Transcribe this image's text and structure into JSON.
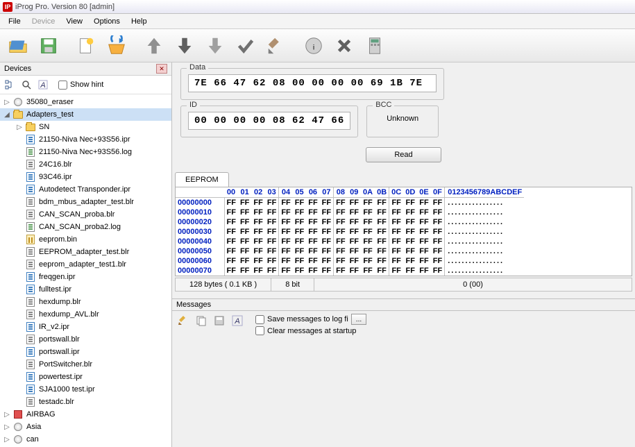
{
  "window": {
    "title": "iProg Pro. Version 80 [admin]"
  },
  "menu": {
    "file": "File",
    "device": "Device",
    "view": "View",
    "options": "Options",
    "help": "Help"
  },
  "devices": {
    "title": "Devices",
    "showhint": "Show hint",
    "tree": [
      {
        "depth": 0,
        "exp": "▷",
        "icon": "light",
        "label": "35080_eraser"
      },
      {
        "depth": 0,
        "exp": "◢",
        "icon": "folder",
        "label": "Adapters_test",
        "selected": true
      },
      {
        "depth": 1,
        "exp": "▷",
        "icon": "folder",
        "label": "SN"
      },
      {
        "depth": 1,
        "exp": "",
        "icon": "ipr",
        "label": "21150-Niva Nec+93S56.ipr"
      },
      {
        "depth": 1,
        "exp": "",
        "icon": "log",
        "label": "21150-Niva Nec+93S56.log"
      },
      {
        "depth": 1,
        "exp": "",
        "icon": "blr",
        "label": "24C16.blr"
      },
      {
        "depth": 1,
        "exp": "",
        "icon": "ipr",
        "label": "93C46.ipr"
      },
      {
        "depth": 1,
        "exp": "",
        "icon": "ipr",
        "label": "Autodetect Transponder.ipr"
      },
      {
        "depth": 1,
        "exp": "",
        "icon": "blr",
        "label": "bdm_mbus_adapter_test.blr"
      },
      {
        "depth": 1,
        "exp": "",
        "icon": "blr",
        "label": "CAN_SCAN_proba.blr"
      },
      {
        "depth": 1,
        "exp": "",
        "icon": "log",
        "label": "CAN_SCAN_proba2.log"
      },
      {
        "depth": 1,
        "exp": "",
        "icon": "bin",
        "label": "eeprom.bin"
      },
      {
        "depth": 1,
        "exp": "",
        "icon": "blr",
        "label": "EEPROM_adapter_test.blr"
      },
      {
        "depth": 1,
        "exp": "",
        "icon": "blr",
        "label": "eeprom_adapter_test1.blr"
      },
      {
        "depth": 1,
        "exp": "",
        "icon": "ipr",
        "label": "freqgen.ipr"
      },
      {
        "depth": 1,
        "exp": "",
        "icon": "ipr",
        "label": "fulltest.ipr"
      },
      {
        "depth": 1,
        "exp": "",
        "icon": "blr",
        "label": "hexdump.blr"
      },
      {
        "depth": 1,
        "exp": "",
        "icon": "blr",
        "label": "hexdump_AVL.blr"
      },
      {
        "depth": 1,
        "exp": "",
        "icon": "ipr",
        "label": "IR_v2.ipr"
      },
      {
        "depth": 1,
        "exp": "",
        "icon": "blr",
        "label": "portswall.blr"
      },
      {
        "depth": 1,
        "exp": "",
        "icon": "ipr",
        "label": "portswall.ipr"
      },
      {
        "depth": 1,
        "exp": "",
        "icon": "blr",
        "label": "PortSwitcher.blr"
      },
      {
        "depth": 1,
        "exp": "",
        "icon": "ipr",
        "label": "powertest.ipr"
      },
      {
        "depth": 1,
        "exp": "",
        "icon": "ipr",
        "label": "SJA1000 test.ipr"
      },
      {
        "depth": 1,
        "exp": "",
        "icon": "blr",
        "label": "testadc.blr"
      },
      {
        "depth": 0,
        "exp": "▷",
        "icon": "square",
        "label": "AIRBAG"
      },
      {
        "depth": 0,
        "exp": "▷",
        "icon": "light",
        "label": "Asia"
      },
      {
        "depth": 0,
        "exp": "▷",
        "icon": "light",
        "label": "can"
      }
    ]
  },
  "data_field": {
    "legend": "Data",
    "value": "7E 66 47 62 08 00 00 00 00 69 1B 7E"
  },
  "id_field": {
    "legend": "ID",
    "value": "00 00 00 00 08 62 47 66"
  },
  "bcc_field": {
    "legend": "BCC",
    "value": "Unknown"
  },
  "read_btn": "Read",
  "eeprom": {
    "tab": "EEPROM",
    "col_headers": [
      "00",
      "01",
      "02",
      "03",
      "04",
      "05",
      "06",
      "07",
      "08",
      "09",
      "0A",
      "0B",
      "0C",
      "0D",
      "0E",
      "0F"
    ],
    "ascii_header": "0123456789ABCDEF",
    "rows": [
      {
        "addr": "00000000",
        "bytes": [
          "FF",
          "FF",
          "FF",
          "FF",
          "FF",
          "FF",
          "FF",
          "FF",
          "FF",
          "FF",
          "FF",
          "FF",
          "FF",
          "FF",
          "FF",
          "FF"
        ],
        "ascii": "................"
      },
      {
        "addr": "00000010",
        "bytes": [
          "FF",
          "FF",
          "FF",
          "FF",
          "FF",
          "FF",
          "FF",
          "FF",
          "FF",
          "FF",
          "FF",
          "FF",
          "FF",
          "FF",
          "FF",
          "FF"
        ],
        "ascii": "................"
      },
      {
        "addr": "00000020",
        "bytes": [
          "FF",
          "FF",
          "FF",
          "FF",
          "FF",
          "FF",
          "FF",
          "FF",
          "FF",
          "FF",
          "FF",
          "FF",
          "FF",
          "FF",
          "FF",
          "FF"
        ],
        "ascii": "................"
      },
      {
        "addr": "00000030",
        "bytes": [
          "FF",
          "FF",
          "FF",
          "FF",
          "FF",
          "FF",
          "FF",
          "FF",
          "FF",
          "FF",
          "FF",
          "FF",
          "FF",
          "FF",
          "FF",
          "FF"
        ],
        "ascii": "................"
      },
      {
        "addr": "00000040",
        "bytes": [
          "FF",
          "FF",
          "FF",
          "FF",
          "FF",
          "FF",
          "FF",
          "FF",
          "FF",
          "FF",
          "FF",
          "FF",
          "FF",
          "FF",
          "FF",
          "FF"
        ],
        "ascii": "................"
      },
      {
        "addr": "00000050",
        "bytes": [
          "FF",
          "FF",
          "FF",
          "FF",
          "FF",
          "FF",
          "FF",
          "FF",
          "FF",
          "FF",
          "FF",
          "FF",
          "FF",
          "FF",
          "FF",
          "FF"
        ],
        "ascii": "................"
      },
      {
        "addr": "00000060",
        "bytes": [
          "FF",
          "FF",
          "FF",
          "FF",
          "FF",
          "FF",
          "FF",
          "FF",
          "FF",
          "FF",
          "FF",
          "FF",
          "FF",
          "FF",
          "FF",
          "FF"
        ],
        "ascii": "................"
      },
      {
        "addr": "00000070",
        "bytes": [
          "FF",
          "FF",
          "FF",
          "FF",
          "FF",
          "FF",
          "FF",
          "FF",
          "FF",
          "FF",
          "FF",
          "FF",
          "FF",
          "FF",
          "FF",
          "FF"
        ],
        "ascii": "................"
      }
    ],
    "status": {
      "size": "128 bytes ( 0.1 KB )",
      "bits": "8 bit",
      "pos": "0 (00)"
    }
  },
  "messages": {
    "title": "Messages",
    "save_log": "Save messages to log fi",
    "browse": "...",
    "clear_startup": "Clear messages at startup"
  }
}
